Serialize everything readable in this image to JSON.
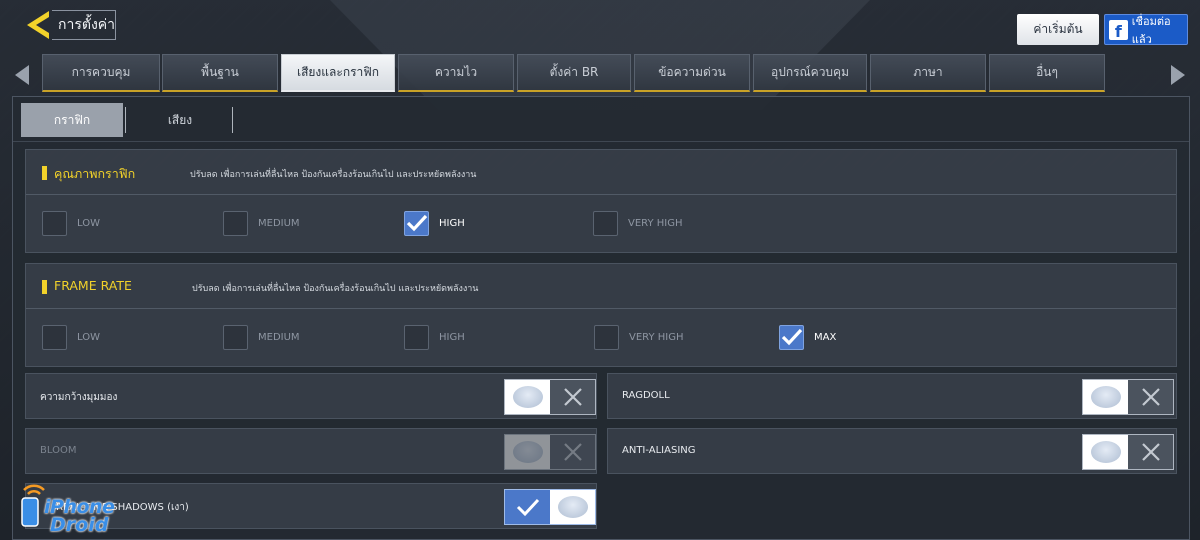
{
  "header": {
    "title": "การตั้งค่า",
    "reset_label": "ค่าเริ่มต้น",
    "facebook_label": "เชื่อมต่อแล้ว",
    "facebook_glyph": "f"
  },
  "tabs": [
    {
      "label": "การควบคุม",
      "active": false
    },
    {
      "label": "พื้นฐาน",
      "active": false
    },
    {
      "label": "เสียงและกราฟิก",
      "active": true
    },
    {
      "label": "ความไว",
      "active": false
    },
    {
      "label": "ตั้งค่า BR",
      "active": false
    },
    {
      "label": "ข้อความด่วน",
      "active": false
    },
    {
      "label": "อุปกรณ์ควบคุม",
      "active": false
    },
    {
      "label": "ภาษา",
      "active": false
    },
    {
      "label": "อื่นๆ",
      "active": false
    }
  ],
  "subtabs": [
    {
      "label": "กราฟิก",
      "active": true
    },
    {
      "label": "เสียง",
      "active": false
    }
  ],
  "graphics_quality": {
    "title": "คุณภาพกราฟิก",
    "description": "ปรับลด เพื่อการเล่นที่ลื่นไหล ป้องกันเครื่องร้อนเกินไป และประหยัดพลังงาน",
    "options": [
      {
        "label": "LOW",
        "checked": false
      },
      {
        "label": "MEDIUM",
        "checked": false
      },
      {
        "label": "HIGH",
        "checked": true
      },
      {
        "label": "VERY HIGH",
        "checked": false
      }
    ]
  },
  "frame_rate": {
    "title": "FRAME RATE",
    "description": "ปรับลด เพื่อการเล่นที่ลื่นไหล ป้องกันเครื่องร้อนเกินไป และประหยัดพลังงาน",
    "options": [
      {
        "label": "LOW",
        "checked": false
      },
      {
        "label": "MEDIUM",
        "checked": false
      },
      {
        "label": "HIGH",
        "checked": false
      },
      {
        "label": "VERY HIGH",
        "checked": false
      },
      {
        "label": "MAX",
        "checked": true
      }
    ]
  },
  "toggles": {
    "fov": {
      "label": "ความกว้างมุมมอง",
      "on": false,
      "enabled": true
    },
    "ragdoll": {
      "label": "RAGDOLL",
      "on": false,
      "enabled": true
    },
    "bloom": {
      "label": "BLOOM",
      "on": false,
      "enabled": false
    },
    "anti_aliasing": {
      "label": "ANTI-ALIASING",
      "on": false,
      "enabled": true
    },
    "shadows": {
      "label": "REAL-TIME SHADOWS (เงา)",
      "on": true,
      "enabled": true
    }
  },
  "watermark": {
    "line1": "iPhone",
    "line2": "Droid"
  },
  "colors": {
    "accent": "#f2d22a",
    "check_blue": "#4b78c9",
    "facebook": "#1b5bc7"
  }
}
